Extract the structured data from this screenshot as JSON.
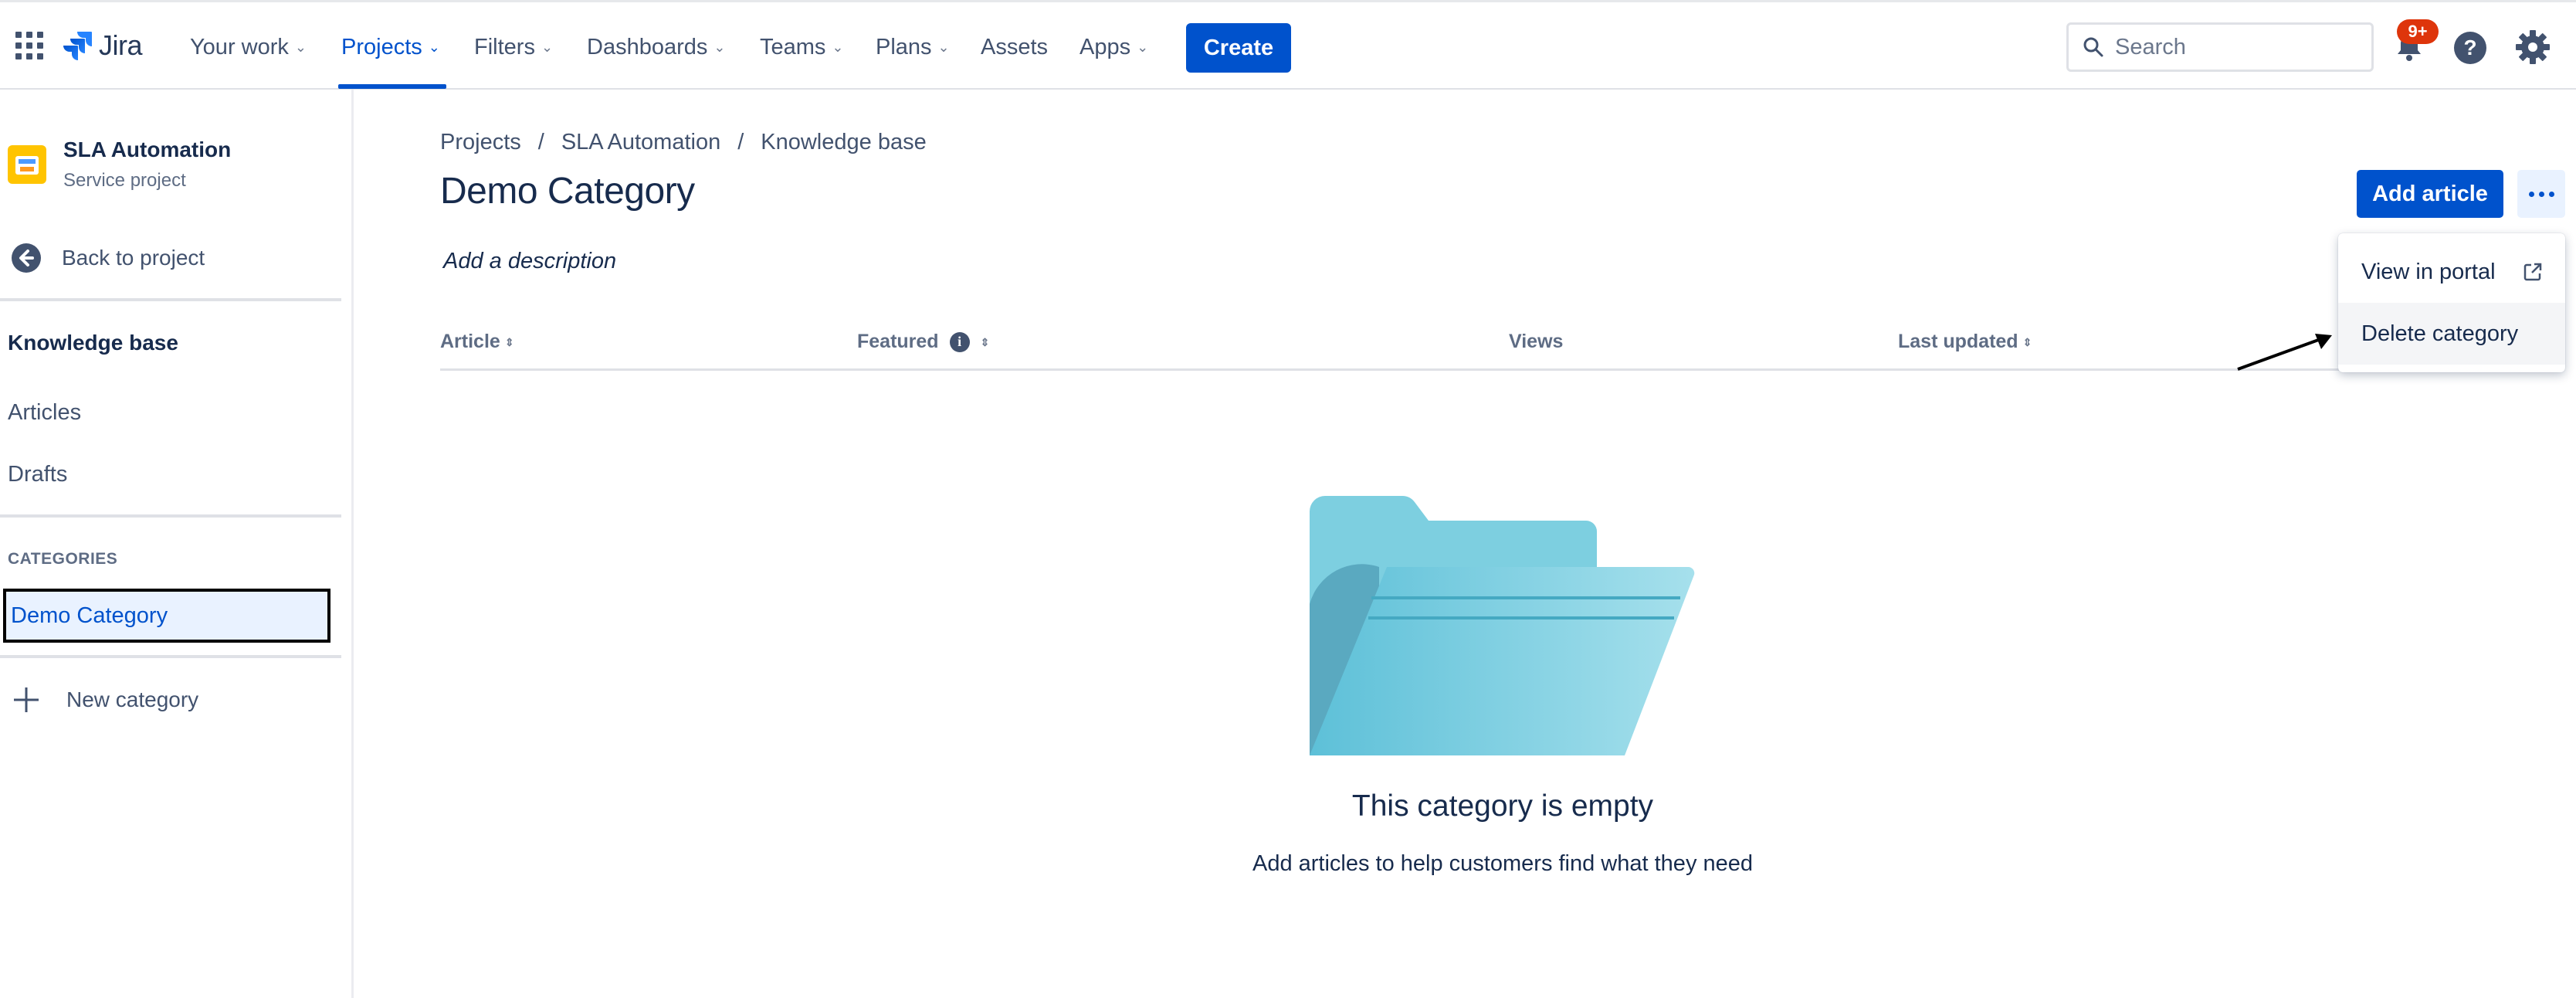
{
  "topnav": {
    "logo_text": "Jira",
    "items": [
      {
        "label": "Your work"
      },
      {
        "label": "Projects"
      },
      {
        "label": "Filters"
      },
      {
        "label": "Dashboards"
      },
      {
        "label": "Teams"
      },
      {
        "label": "Plans"
      },
      {
        "label": "Assets"
      },
      {
        "label": "Apps"
      }
    ],
    "active_item": "Projects",
    "create_label": "Create",
    "search_placeholder": "Search",
    "notification_badge": "9+"
  },
  "sidebar": {
    "project_name": "SLA Automation",
    "project_type": "Service project",
    "back_label": "Back to project",
    "section_heading": "Knowledge base",
    "links": [
      "Articles",
      "Drafts"
    ],
    "categories_heading": "CATEGORIES",
    "active_category": "Demo Category",
    "new_category_label": "New category"
  },
  "main": {
    "breadcrumbs": [
      "Projects",
      "SLA Automation",
      "Knowledge base"
    ],
    "breadcrumb_separator": "/",
    "title": "Demo Category",
    "description_placeholder": "Add a description",
    "add_article_label": "Add article",
    "table_headers": [
      "Article",
      "Featured",
      "Views",
      "Last updated"
    ],
    "empty_title": "This category is empty",
    "empty_subtitle": "Add articles to help customers find what they need"
  },
  "dropdown": {
    "items": [
      "View in portal",
      "Delete category"
    ],
    "hovered_item": "Delete category"
  },
  "colors": {
    "primary": "#0052cc",
    "text": "#172b4d",
    "subtle_text": "#42526e",
    "badge": "#de350b",
    "folder": "#6cc8dd"
  }
}
